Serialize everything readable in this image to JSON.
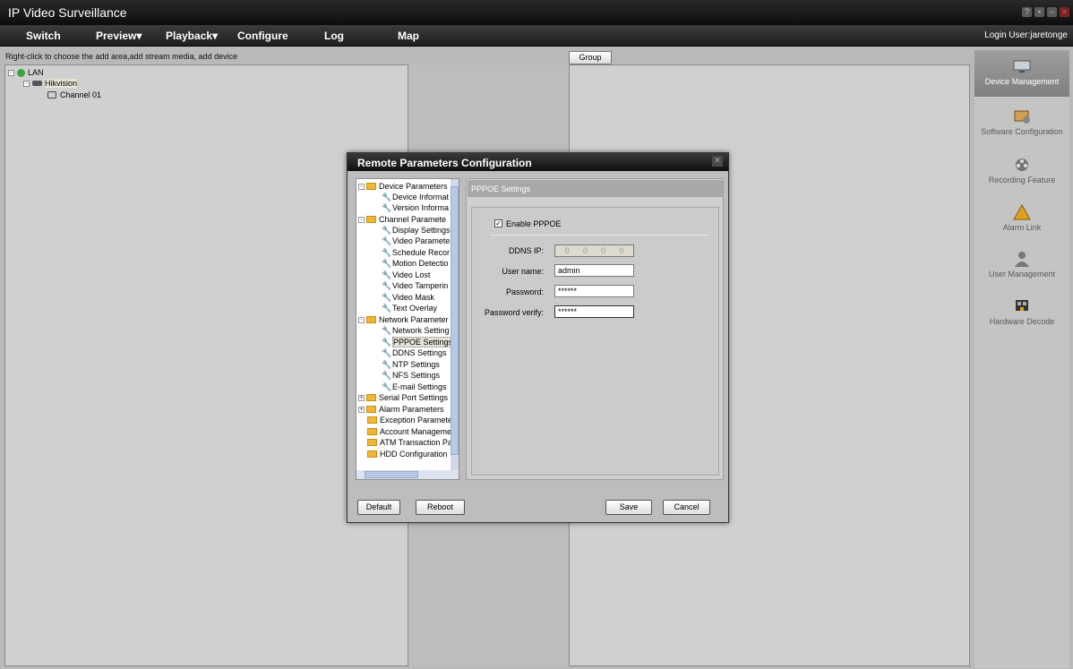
{
  "app": {
    "title": "IP Video Surveillance"
  },
  "menu": {
    "items": [
      "Switch",
      "Preview▾",
      "Playback▾",
      "Configure",
      "Log",
      "Map"
    ],
    "login_user": "Login User:jaretonge"
  },
  "hint": "Right-click to choose the add area,add stream media, add device",
  "group_button": "Group",
  "device_tree": {
    "root": "LAN",
    "device": "Hikvision",
    "channel": "Channel 01"
  },
  "sidebar": {
    "items": [
      {
        "label": "Device Management",
        "icon": "monitor-icon",
        "active": true
      },
      {
        "label": "Software Configuration",
        "icon": "software-config-icon",
        "active": false
      },
      {
        "label": "Recording Feature",
        "icon": "film-reel-icon",
        "active": false
      },
      {
        "label": "Alarm Link",
        "icon": "warning-icon",
        "active": false
      },
      {
        "label": "User Management",
        "icon": "user-icon",
        "active": false
      },
      {
        "label": "Hardware Decode",
        "icon": "hardware-decode-icon",
        "active": false
      }
    ]
  },
  "dialog": {
    "title": "Remote Parameters Configuration",
    "tree": {
      "device_parameters": "Device Parameters",
      "device_information": "Device Informat",
      "version_information": "Version Informa",
      "channel_parameters": "Channel Paramete",
      "display_settings": "Display Settings",
      "video_parameters": "Video Paramete",
      "schedule_record": "Schedule Recor",
      "motion_detection": "Motion Detectio",
      "video_lost": "Video Lost",
      "video_tampering": "Video Tamperin",
      "video_mask": "Video Mask",
      "text_overlay": "Text Overlay",
      "network_parameters": "Network Parameter",
      "network_settings": "Network Setting",
      "pppoe_settings": "PPPOE Settings",
      "ddns_settings": "DDNS Settings",
      "ntp_settings": "NTP Settings",
      "nfs_settings": "NFS Settings",
      "email_settings": "E-mail Settings",
      "serial_port_settings": "Serial Port Settings",
      "alarm_parameters": "Alarm Parameters",
      "exception_parameters": "Exception Paramete",
      "account_management": "Account Manageme",
      "atm_transaction": "ATM Transaction Pa",
      "hdd_configuration": "HDD Configuration"
    },
    "section_title": "PPPOE Settings",
    "enable_pppoe": {
      "label": "Enable PPPOE",
      "checked": true
    },
    "fields": {
      "ddns_ip": {
        "label": "DDNS IP:",
        "value": [
          "0",
          "0",
          "0",
          "0"
        ]
      },
      "user_name": {
        "label": "User name:",
        "value": "admin"
      },
      "password": {
        "label": "Password:",
        "value": "******"
      },
      "password_verify": {
        "label": "Password verify:",
        "value": "******"
      }
    },
    "buttons": {
      "default": "Default",
      "reboot": "Reboot",
      "save": "Save",
      "cancel": "Cancel"
    }
  }
}
